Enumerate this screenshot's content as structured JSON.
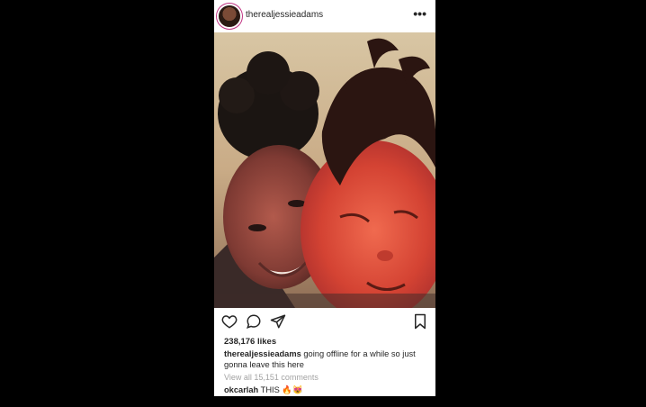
{
  "post": {
    "username": "therealjessieadams",
    "more_icon": "more-horizontal-icon",
    "likes": "238,176 likes",
    "caption_user": "therealjessieadams",
    "caption_text": " going offline for a while so just gonna leave this here",
    "view_comments": "View all 15,151 comments",
    "comment_user": "okcarlah",
    "comment_text": " THIS 🔥😻"
  },
  "icons": {
    "like": "heart-icon",
    "comment": "comment-icon",
    "share": "share-icon",
    "save": "bookmark-icon"
  },
  "colors": {
    "text": "#262626",
    "muted": "#a3a3a3",
    "background": "#000000"
  }
}
